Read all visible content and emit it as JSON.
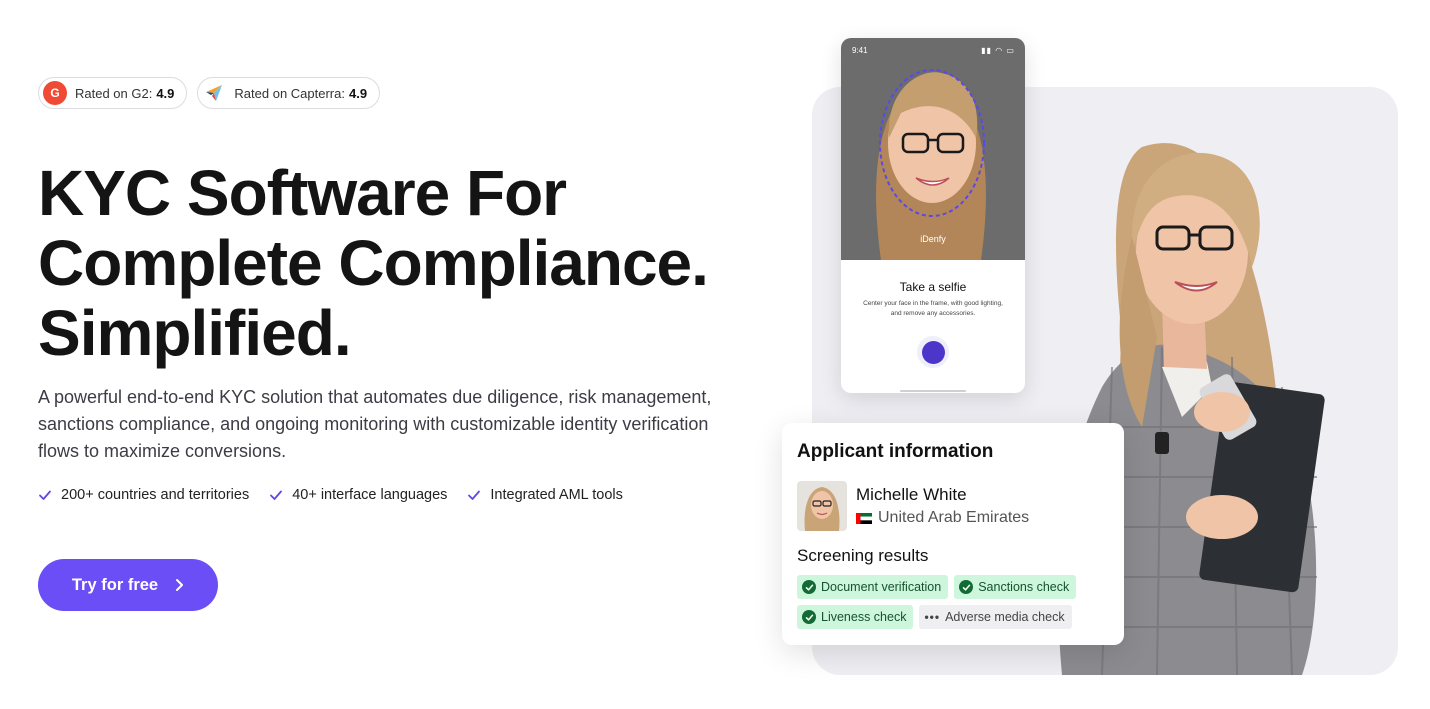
{
  "ratings": [
    {
      "icon": "g2-logo-icon",
      "label": "Rated on G2:",
      "score": "4.9"
    },
    {
      "icon": "capterra-logo-icon",
      "label": "Rated on Capterra:",
      "score": "4.9"
    }
  ],
  "hero": {
    "title_lines": [
      "KYC Software For",
      "Complete Compliance.",
      "Simplified."
    ],
    "subtitle": "A powerful end-to-end KYC solution that automates due diligence, risk management, sanctions compliance, and ongoing monitoring with customizable identity verification flows to maximize conversions."
  },
  "features": [
    "200+ countries and territories",
    "40+ interface languages",
    "Integrated AML tools"
  ],
  "cta": {
    "label": "Try for free",
    "icon": "chevron-right-icon"
  },
  "phone": {
    "time": "9:41",
    "brand": "iDenfy",
    "title": "Take a selfie",
    "description": "Center your face in the frame, with good lighting, and remove any accessories."
  },
  "applicant_card": {
    "title": "Applicant information",
    "name": "Michelle White",
    "country": "United Arab Emirates",
    "screening_title": "Screening results",
    "checks": [
      {
        "label": "Document verification",
        "status": "passed"
      },
      {
        "label": "Sanctions check",
        "status": "passed"
      },
      {
        "label": "Liveness check",
        "status": "passed"
      },
      {
        "label": "Adverse media check",
        "status": "pending"
      }
    ]
  },
  "colors": {
    "accent": "#6b4ef5",
    "shutter": "#4b36c9",
    "success_bg": "#cdf6dc",
    "success_icon": "#136b34",
    "check_icon": "#5b48e6"
  }
}
